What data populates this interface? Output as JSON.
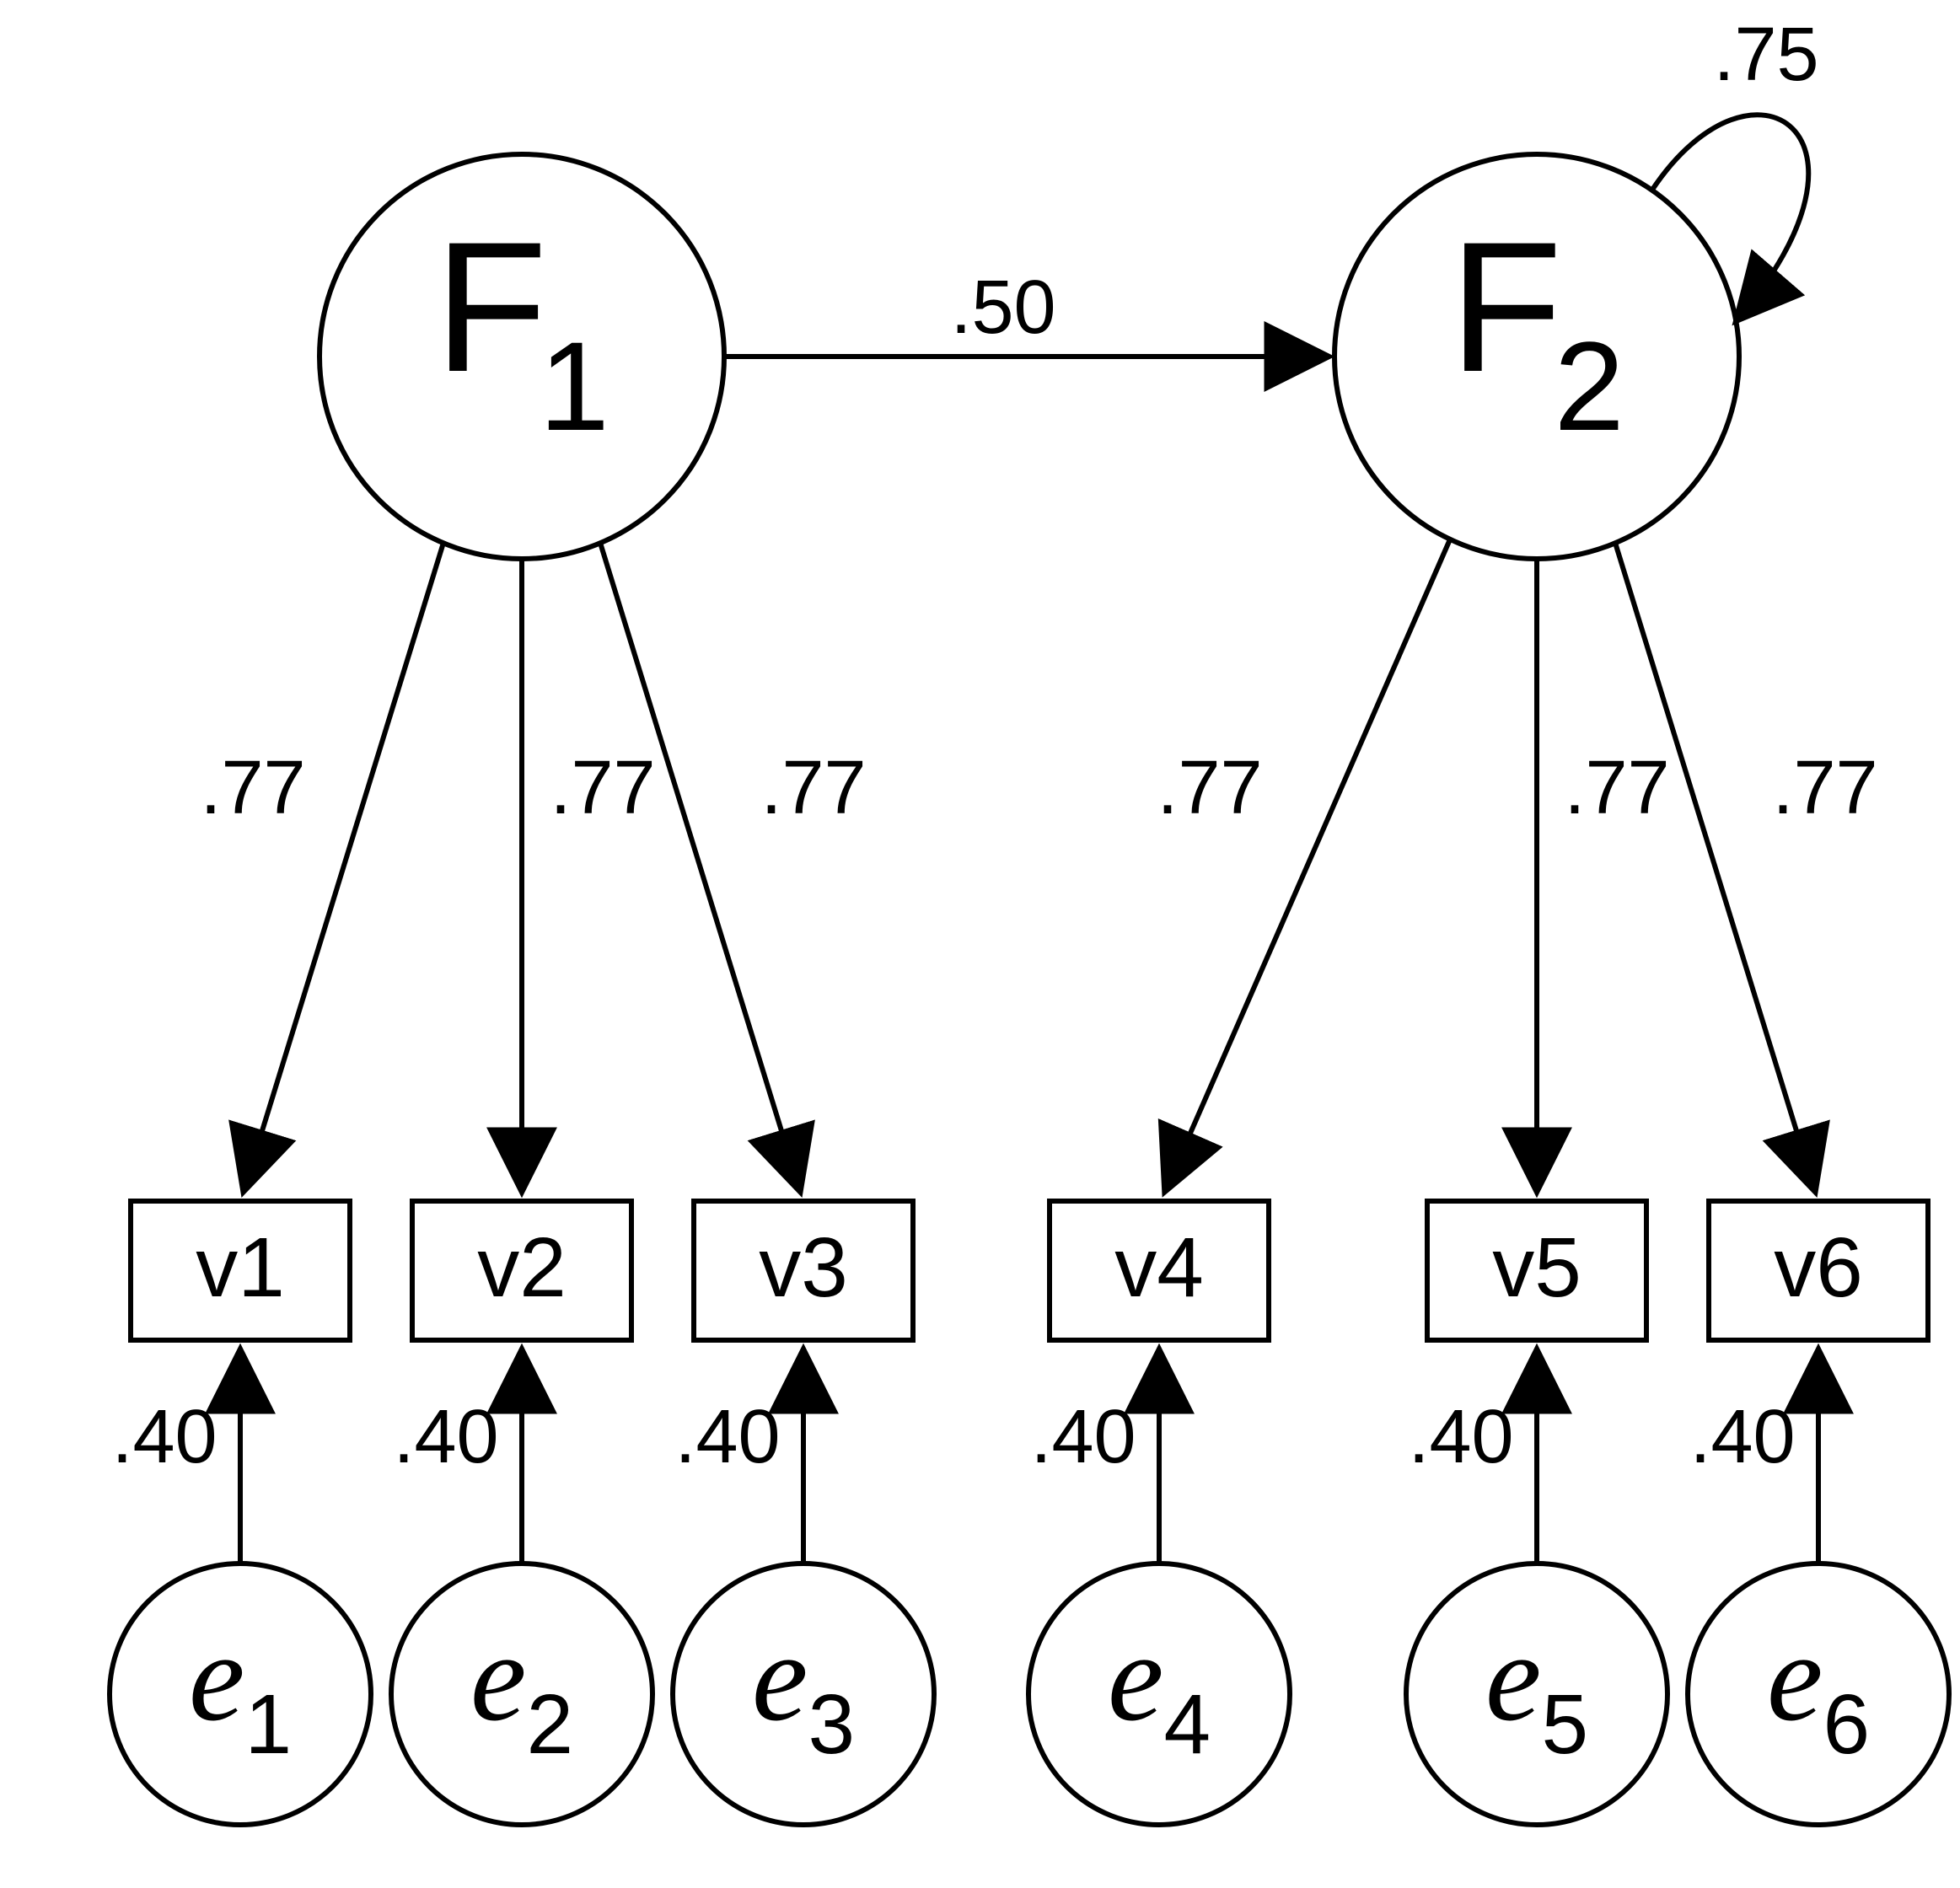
{
  "factors": {
    "F1": {
      "main": "F",
      "sub": "1"
    },
    "F2": {
      "main": "F",
      "sub": "2"
    }
  },
  "observed": {
    "v1": "v1",
    "v2": "v2",
    "v3": "v3",
    "v4": "v4",
    "v5": "v5",
    "v6": "v6"
  },
  "errors": {
    "e1": {
      "main": "e",
      "sub": "1"
    },
    "e2": {
      "main": "e",
      "sub": "2"
    },
    "e3": {
      "main": "e",
      "sub": "3"
    },
    "e4": {
      "main": "e",
      "sub": "4"
    },
    "e5": {
      "main": "e",
      "sub": "5"
    },
    "e6": {
      "main": "e",
      "sub": "6"
    }
  },
  "paths": {
    "F1_F2": ".50",
    "F2_self": ".75",
    "loading_v1": ".77",
    "loading_v2": ".77",
    "loading_v3": ".77",
    "loading_v4": ".77",
    "loading_v5": ".77",
    "loading_v6": ".77",
    "err_v1": ".40",
    "err_v2": ".40",
    "err_v3": ".40",
    "err_v4": ".40",
    "err_v5": ".40",
    "err_v6": ".40"
  }
}
